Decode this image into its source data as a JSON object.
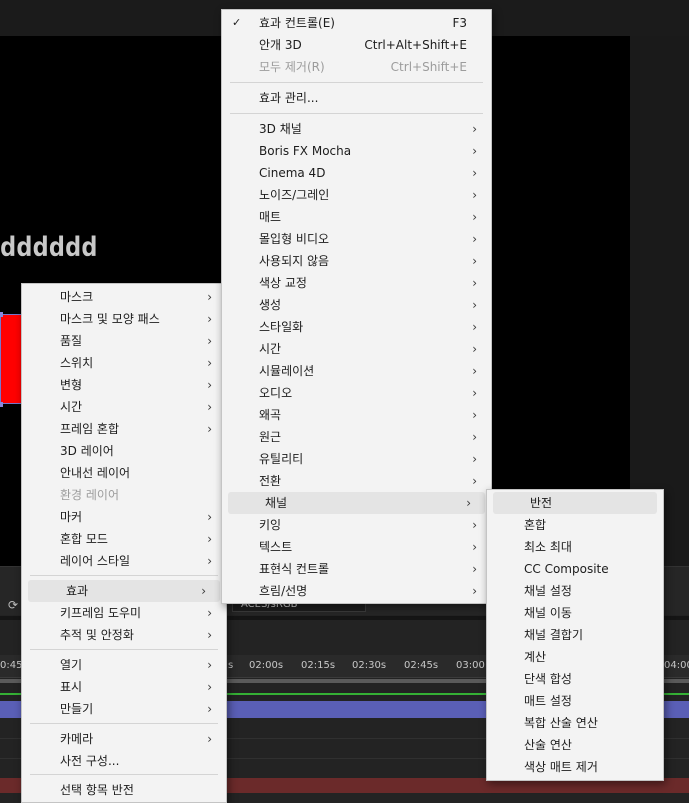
{
  "composition": {
    "text": "dddddd"
  },
  "color_dropdown": {
    "label": "ACES/sRGB"
  },
  "timeline": {
    "ticks": [
      "0:45",
      "s",
      "02:00s",
      "02:15s",
      "02:30s",
      "02:45s",
      "03:00",
      "04:00"
    ]
  },
  "context_menu": {
    "groups": [
      [
        {
          "label": "마스크",
          "submenu": true
        },
        {
          "label": "마스크 및 모양 패스",
          "submenu": true
        },
        {
          "label": "품질",
          "submenu": true
        },
        {
          "label": "스위치",
          "submenu": true
        },
        {
          "label": "변형",
          "submenu": true
        },
        {
          "label": "시간",
          "submenu": true
        },
        {
          "label": "프레임 혼합",
          "submenu": true
        },
        {
          "label": "3D 레이어",
          "submenu": false
        },
        {
          "label": "안내선 레이어",
          "submenu": false
        },
        {
          "label": "환경 레이어",
          "submenu": false,
          "disabled": true
        },
        {
          "label": "마커",
          "submenu": true
        },
        {
          "label": "혼합 모드",
          "submenu": true
        },
        {
          "label": "레이어 스타일",
          "submenu": true
        }
      ],
      [
        {
          "label": "효과",
          "submenu": true,
          "highlighted": true
        },
        {
          "label": "키프레임 도우미",
          "submenu": true
        },
        {
          "label": "추적 및 안정화",
          "submenu": true
        }
      ],
      [
        {
          "label": "열기",
          "submenu": true
        },
        {
          "label": "표시",
          "submenu": true
        },
        {
          "label": "만들기",
          "submenu": true
        }
      ],
      [
        {
          "label": "카메라",
          "submenu": true
        },
        {
          "label": "사전 구성...",
          "submenu": false
        }
      ],
      [
        {
          "label": "선택 항목 반전",
          "submenu": false
        }
      ]
    ]
  },
  "effects_menu": {
    "top": [
      {
        "label": "효과 컨트롤(E)",
        "shortcut": "F3",
        "checked": true
      },
      {
        "label": "안개 3D",
        "shortcut": "Ctrl+Alt+Shift+E"
      },
      {
        "label": "모두 제거(R)",
        "shortcut": "Ctrl+Shift+E",
        "disabled": true
      }
    ],
    "manage": {
      "label": "효과 관리..."
    },
    "categories": [
      "3D 채널",
      "Boris FX Mocha",
      "Cinema 4D",
      "노이즈/그레인",
      "매트",
      "몰입형 비디오",
      "사용되지 않음",
      "색상 교정",
      "생성",
      "스타일화",
      "시간",
      "시뮬레이션",
      "오디오",
      "왜곡",
      "원근",
      "유틸리티",
      "전환",
      "채널",
      "키잉",
      "텍스트",
      "표현식 컨트롤",
      "흐림/선명"
    ],
    "highlighted_category": "채널"
  },
  "channel_menu": {
    "items": [
      "반전",
      "혼합",
      "최소 최대",
      "CC Composite",
      "채널 설정",
      "채널 이동",
      "채널 결합기",
      "계산",
      "단색 합성",
      "매트 설정",
      "복합 산술 연산",
      "산술 연산",
      "색상 매트 제거"
    ],
    "highlighted": "반전"
  }
}
